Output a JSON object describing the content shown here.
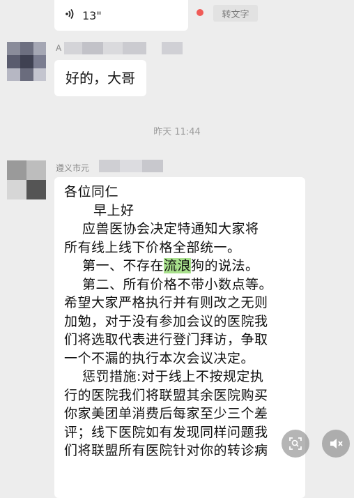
{
  "voice_message": {
    "icon": "voice-wave-icon",
    "duration": "13\"",
    "transcribe_label": "转文字",
    "unread_color": "#f05b57"
  },
  "message1": {
    "sender": "A",
    "text": "好的，大哥"
  },
  "timestamp": "昨天 11:44",
  "message2": {
    "sender": "遵义市元",
    "lines": [
      "各位同仁",
      "早上好",
      "应兽医协会决定特通知大家将",
      "所有线上线下价格全部统一。",
      "第一、不存在",
      "流浪",
      "狗的说法。",
      "第二、所有价格不带小数点等。",
      "希望大家严格执行并有则改之无则",
      "加勉，对于没有参加会议的医院我",
      "们将选取代表进行登门拜访，争取",
      "一个不漏的执行本次会议决定。",
      "惩罚措施:对于线上不按规定执",
      "行的医院我们将联盟其余医院购买",
      "你家美团单消费后每家至少三个差",
      "评；线下医院如有发现同样问题我",
      "们将联盟所有医院针对你的转诊病"
    ]
  },
  "floating": {
    "search_icon": "image-search-icon",
    "mute_icon": "mute-icon"
  }
}
